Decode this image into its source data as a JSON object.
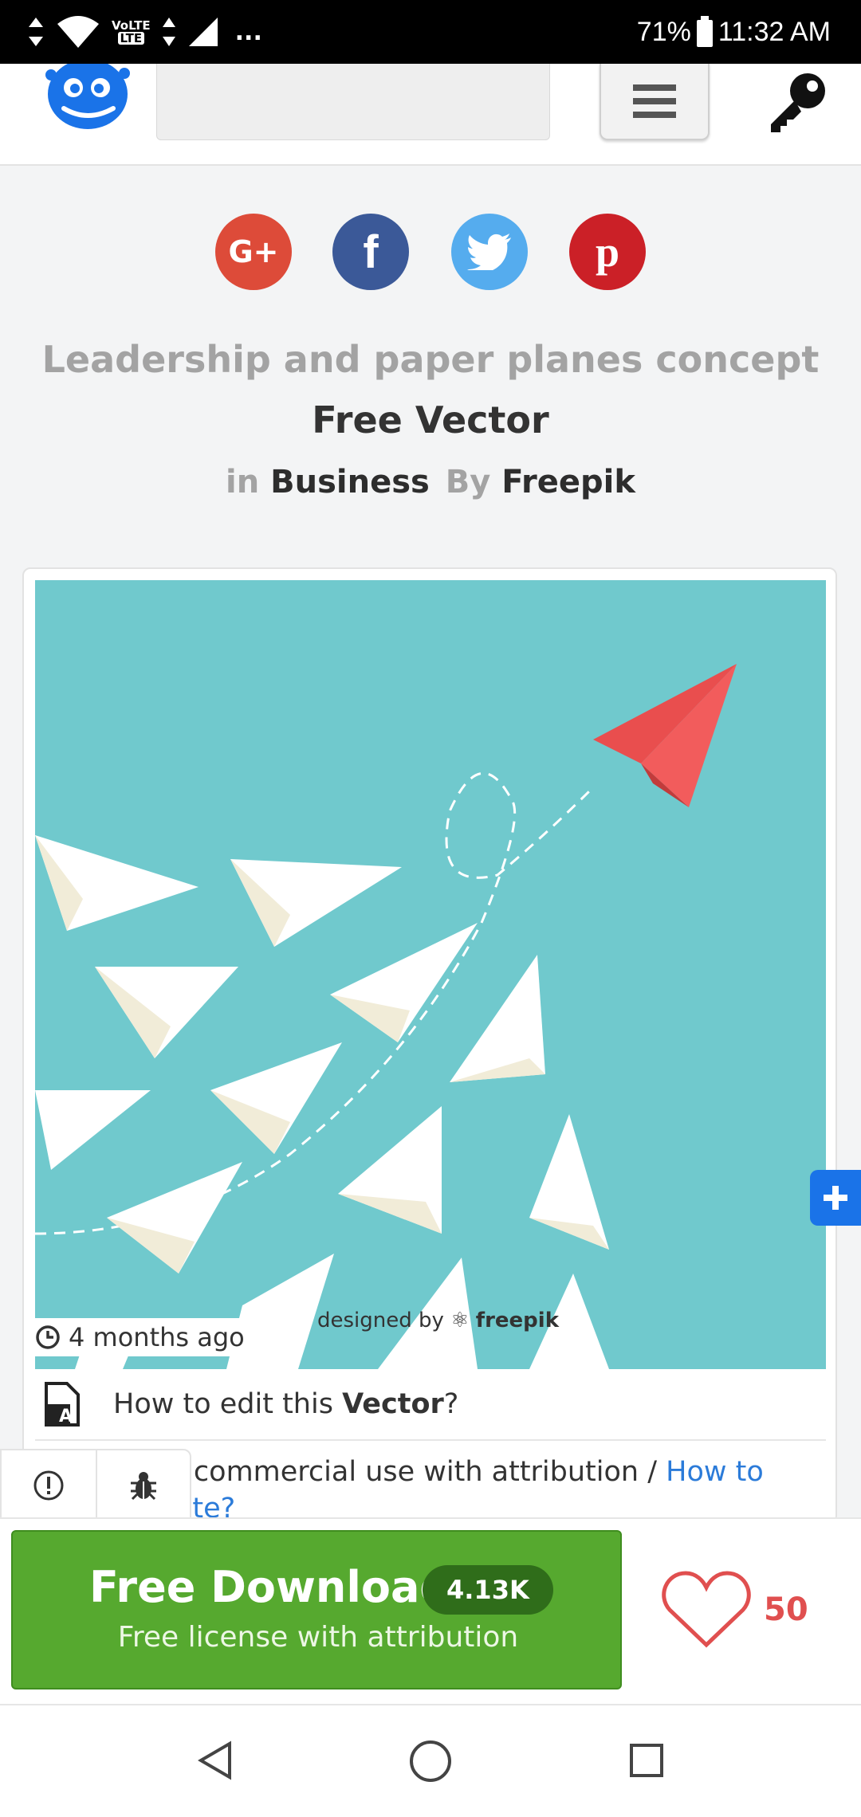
{
  "status_bar": {
    "battery": "71%",
    "time": "11:32 AM",
    "network_badge": "LTE",
    "more": "..."
  },
  "header": {
    "logo_icon": "freepik-robot-logo",
    "search_placeholder": "",
    "menu_icon": "hamburger-icon",
    "login_icon": "key-icon"
  },
  "social": [
    {
      "name": "google-plus",
      "label": "G+",
      "color": "#dd4b39"
    },
    {
      "name": "facebook",
      "label": "f",
      "color": "#3b5998"
    },
    {
      "name": "twitter",
      "label": "twitter",
      "color": "#55acee"
    },
    {
      "name": "pinterest",
      "label": "P",
      "color": "#cb2027"
    }
  ],
  "resource": {
    "title": "Leadership and paper planes concept",
    "type": "Free Vector",
    "in_label": "in",
    "category": "Business",
    "by_label": "By",
    "author": "Freepik",
    "watermark_prefix": "designed by",
    "watermark_brand": "freepik",
    "age": "4 months ago"
  },
  "info_rows": {
    "howto_prefix": "How to edit this ",
    "howto_bold": "Vector",
    "howto_suffix": "?",
    "license_text": "or commercial use with attribution / ",
    "license_link": "How to attribute?"
  },
  "download": {
    "label": "Free Download",
    "count": "4.13K",
    "sub_label": "Free license with attribution"
  },
  "likes": {
    "count": "50"
  },
  "colors": {
    "preview_bg": "#70c9cd",
    "download_green": "#56a92f",
    "like_red": "#e04f4f",
    "fab_blue": "#1a73e8"
  }
}
